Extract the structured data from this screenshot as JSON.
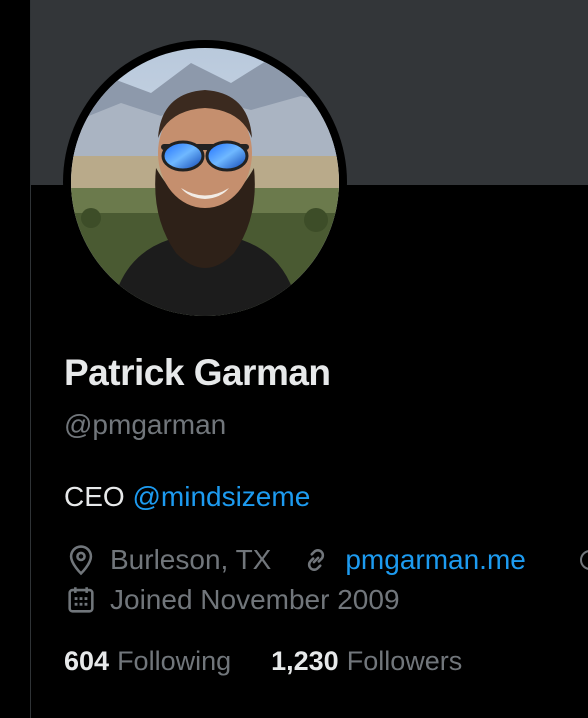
{
  "profile": {
    "name": "Patrick Garman",
    "handle": "@pmgarman",
    "bio_text": "CEO",
    "bio_mention": "@mindsizeme",
    "location": "Burleson, TX",
    "website": "pmgarman.me",
    "joined": "Joined November 2009"
  },
  "stats": {
    "following_count": "604",
    "following_label": "Following",
    "followers_count": "1,230",
    "followers_label": "Followers"
  },
  "icons": {
    "location": "location-pin-icon",
    "website": "link-icon",
    "joined": "calendar-icon",
    "partial": "birthday-icon"
  },
  "colors": {
    "background": "#000000",
    "banner": "#333639",
    "primary_text": "#e7e9ea",
    "secondary_text": "#71767b",
    "accent": "#1d9bf0"
  }
}
